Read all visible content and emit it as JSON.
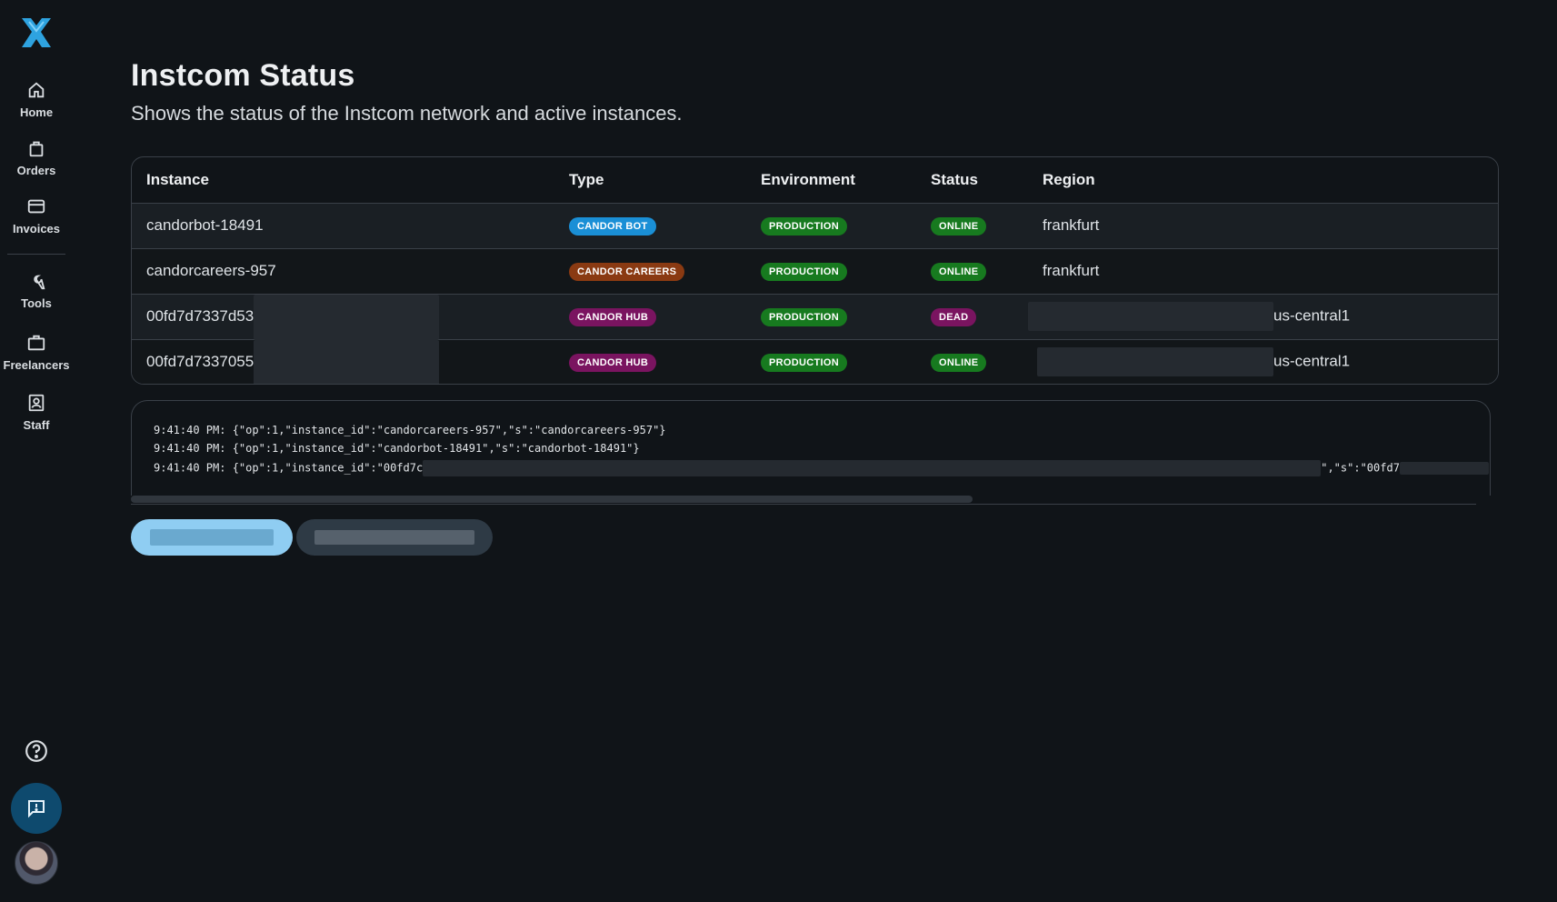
{
  "sidebar": {
    "items": [
      {
        "label": "Home",
        "icon": "home-icon"
      },
      {
        "label": "Orders",
        "icon": "bag-icon"
      },
      {
        "label": "Invoices",
        "icon": "card-icon"
      },
      {
        "label": "Tools",
        "icon": "wrench-icon"
      },
      {
        "label": "Freelancers",
        "icon": "briefcase-icon"
      },
      {
        "label": "Staff",
        "icon": "badge-icon"
      }
    ],
    "logo": "candor-logo",
    "help_icon": "help-icon",
    "feedback_icon": "feedback-icon"
  },
  "page": {
    "title": "Instcom Status",
    "subtitle": "Shows the status of the Instcom network and active instances."
  },
  "table": {
    "columns": [
      "Instance",
      "Type",
      "Environment",
      "Status",
      "Region"
    ],
    "rows": [
      {
        "instance": "candorbot-18491",
        "type": "CANDOR BOT",
        "environment": "PRODUCTION",
        "status": "ONLINE",
        "region": "frankfurt"
      },
      {
        "instance": "candorcareers-957",
        "type": "CANDOR CAREERS",
        "environment": "PRODUCTION",
        "status": "ONLINE",
        "region": "frankfurt"
      },
      {
        "instance": "00fd7d7337d53",
        "type": "CANDOR HUB",
        "environment": "PRODUCTION",
        "status": "DEAD",
        "region": "us-central1"
      },
      {
        "instance": "00fd7d7337055",
        "type": "CANDOR HUB",
        "environment": "PRODUCTION",
        "status": "ONLINE",
        "region": "us-central1"
      }
    ]
  },
  "log": {
    "lines": [
      "9:41:40 PM: {\"op\":1,\"instance_id\":\"candorcareers-957\",\"s\":\"candorcareers-957\"}",
      "9:41:40 PM: {\"op\":1,\"instance_id\":\"candorbot-18491\",\"s\":\"candorbot-18491\"}",
      "9:41:40 PM: {\"op\":1,\"instance_id\":\"00fd7c",
      "\",\"s\":\"00fd7"
    ]
  },
  "colors": {
    "badge_candor_bot": "#1a8fd6",
    "badge_candor_careers": "#8a3a12",
    "badge_candor_hub": "#7a1460",
    "badge_production": "#177a1f",
    "badge_online": "#177a1f",
    "badge_dead": "#7a1460",
    "accent": "#8fcdf2"
  }
}
